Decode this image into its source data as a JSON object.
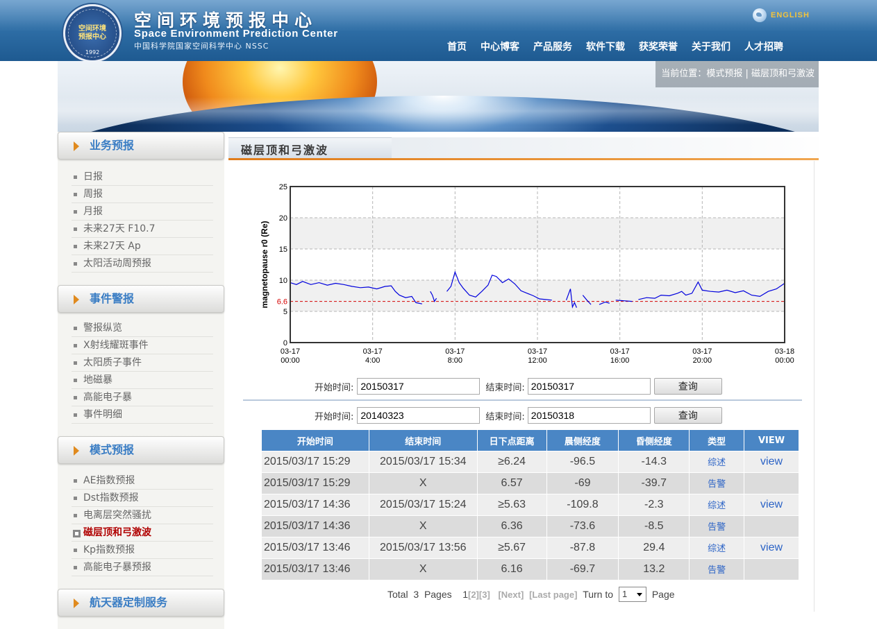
{
  "header": {
    "seal_text_top": "Space Environment Prediction Center",
    "seal_text_mid": "空间环境预报中心",
    "seal_year": "1992",
    "title_cn": "空间环境预报中心",
    "title_en": "Space Environment Prediction Center",
    "subtitle": "中国科学院国家空间科学中心  NSSC",
    "lang_label": "ENGLISH",
    "nav": [
      "首页",
      "中心博客",
      "产品服务",
      "软件下载",
      "获奖荣誉",
      "关于我们",
      "人才招聘"
    ]
  },
  "breadcrumb": {
    "prefix": "当前位置：",
    "part1": "模式预报",
    "sep": " | ",
    "part2": "磁层顶和弓激波"
  },
  "sidebar": {
    "sections": [
      {
        "title": "业务预报",
        "items": [
          "日报",
          "周报",
          "月报",
          "未来27天 F10.7",
          "未来27天 Ap",
          "太阳活动周预报"
        ]
      },
      {
        "title": "事件警报",
        "items": [
          "警报纵览",
          "X射线耀斑事件",
          "太阳质子事件",
          "地磁暴",
          "高能电子暴",
          "事件明细"
        ]
      },
      {
        "title": "模式预报",
        "items": [
          "AE指数预报",
          "Dst指数预报",
          "电离层突然骚扰",
          "磁层顶和弓激波",
          "Kp指数预报",
          "高能电子暴预报"
        ],
        "active_index": 3
      },
      {
        "title": "航天器定制服务",
        "items": []
      }
    ]
  },
  "page_title": "磁层顶和弓激波",
  "chart_data": {
    "type": "line",
    "ylabel": "magnetopause r0 (Re)",
    "ylim": [
      0,
      25
    ],
    "yticks": [
      0,
      5,
      10,
      15,
      20,
      25
    ],
    "xlim_hours": [
      0,
      24
    ],
    "xticks": [
      {
        "hour": 0,
        "l1": "03-17",
        "l2": "00:00"
      },
      {
        "hour": 4,
        "l1": "03-17",
        "l2": "4:00"
      },
      {
        "hour": 8,
        "l1": "03-17",
        "l2": "8:00"
      },
      {
        "hour": 12,
        "l1": "03-17",
        "l2": "12:00"
      },
      {
        "hour": 16,
        "l1": "03-17",
        "l2": "16:00"
      },
      {
        "hour": 20,
        "l1": "03-17",
        "l2": "20:00"
      },
      {
        "hour": 24,
        "l1": "03-18",
        "l2": "00:00"
      }
    ],
    "threshold": {
      "value": 6.6,
      "label": "6.6",
      "color": "#d40000"
    },
    "series_color": "#0000dd",
    "grid": true,
    "band_fill": "#f0f0f0",
    "segments": [
      [
        [
          0,
          9.6
        ],
        [
          0.3,
          9.3
        ],
        [
          0.6,
          9.8
        ],
        [
          1.0,
          9.3
        ],
        [
          1.4,
          9.6
        ],
        [
          1.8,
          9.2
        ],
        [
          2.2,
          9.5
        ],
        [
          2.6,
          9.3
        ],
        [
          3.0,
          9.0
        ],
        [
          3.4,
          8.8
        ],
        [
          3.8,
          8.9
        ],
        [
          4.2,
          8.6
        ],
        [
          4.6,
          9.0
        ],
        [
          4.9,
          9.1
        ],
        [
          5.1,
          8.2
        ],
        [
          5.3,
          7.6
        ],
        [
          5.6,
          7.2
        ],
        [
          5.9,
          7.4
        ],
        [
          6.1,
          6.4
        ],
        [
          6.4,
          6.2
        ]
      ],
      [
        [
          6.8,
          8.2
        ],
        [
          6.9,
          7.6
        ],
        [
          7.0,
          6.6
        ],
        [
          7.1,
          7.1
        ]
      ],
      [
        [
          7.6,
          8.2
        ],
        [
          7.8,
          9.0
        ],
        [
          8.0,
          11.3
        ],
        [
          8.2,
          9.6
        ],
        [
          8.4,
          8.7
        ],
        [
          8.7,
          7.6
        ],
        [
          9.0,
          7.3
        ],
        [
          9.3,
          8.2
        ],
        [
          9.6,
          9.2
        ],
        [
          9.8,
          10.8
        ],
        [
          10.0,
          10.6
        ],
        [
          10.3,
          9.6
        ],
        [
          10.6,
          10.2
        ],
        [
          10.9,
          9.4
        ],
        [
          11.2,
          8.3
        ],
        [
          11.5,
          7.9
        ],
        [
          11.8,
          7.5
        ],
        [
          12.1,
          7.0
        ],
        [
          12.4,
          6.9
        ],
        [
          12.7,
          6.8
        ]
      ],
      [
        [
          13.4,
          6.8
        ],
        [
          13.6,
          8.6
        ],
        [
          13.7,
          5.7
        ],
        [
          13.8,
          6.4
        ],
        [
          13.9,
          5.6
        ]
      ],
      [
        [
          14.2,
          7.6
        ],
        [
          14.4,
          6.8
        ],
        [
          14.6,
          6.1
        ]
      ],
      [
        [
          15.0,
          6.1
        ],
        [
          15.3,
          6.5
        ],
        [
          15.5,
          6.3
        ]
      ],
      [
        [
          15.8,
          6.8
        ],
        [
          16.2,
          6.7
        ],
        [
          16.6,
          6.6
        ]
      ],
      [
        [
          16.9,
          6.9
        ],
        [
          17.3,
          7.2
        ],
        [
          17.7,
          7.1
        ],
        [
          18.0,
          7.6
        ],
        [
          18.4,
          7.5
        ],
        [
          18.8,
          7.9
        ],
        [
          19.0,
          8.2
        ],
        [
          19.2,
          7.6
        ],
        [
          19.5,
          7.9
        ],
        [
          19.8,
          9.7
        ],
        [
          20.0,
          8.4
        ],
        [
          20.4,
          8.2
        ],
        [
          20.8,
          8.1
        ],
        [
          21.2,
          8.4
        ],
        [
          21.6,
          8.0
        ],
        [
          22.0,
          8.3
        ],
        [
          22.4,
          7.6
        ],
        [
          22.8,
          7.4
        ],
        [
          23.2,
          8.2
        ],
        [
          23.6,
          8.6
        ],
        [
          24.0,
          9.5
        ]
      ]
    ]
  },
  "query1": {
    "start_label": "开始时间:",
    "start_value": "20150317",
    "end_label": "结束时间:",
    "end_value": "20150317",
    "button": "查询"
  },
  "query2": {
    "start_label": "开始时间:",
    "start_value": "20140323",
    "end_label": "结束时间:",
    "end_value": "20150318",
    "button": "查询"
  },
  "table": {
    "headers": [
      "开始时间",
      "结束时间",
      "日下点距离",
      "晨侧经度",
      "昏侧经度",
      "类型",
      "VIEW"
    ],
    "rows": [
      [
        "2015/03/17 15:29",
        "2015/03/17 15:34",
        "≥6.24",
        "-96.5",
        "-14.3",
        "综述",
        "view"
      ],
      [
        "2015/03/17 15:29",
        "X",
        "6.57",
        "-69",
        "-39.7",
        "告警",
        ""
      ],
      [
        "2015/03/17 14:36",
        "2015/03/17 15:24",
        "≥5.63",
        "-109.8",
        "-2.3",
        "综述",
        "view"
      ],
      [
        "2015/03/17 14:36",
        "X",
        "6.36",
        "-73.6",
        "-8.5",
        "告警",
        ""
      ],
      [
        "2015/03/17 13:46",
        "2015/03/17 13:56",
        "≥5.67",
        "-87.8",
        "29.4",
        "综述",
        "view"
      ],
      [
        "2015/03/17 13:46",
        "X",
        "6.16",
        "-69.7",
        "13.2",
        "告警",
        ""
      ]
    ]
  },
  "pager": {
    "total_label": "Total",
    "total_pages": "3",
    "pages_label": "Pages",
    "current": "1",
    "links": [
      "[2]",
      "[3]"
    ],
    "next": "[Next]",
    "last": "[Last page]",
    "turn_to": "Turn to",
    "select_value": "1",
    "page_label": "Page"
  }
}
